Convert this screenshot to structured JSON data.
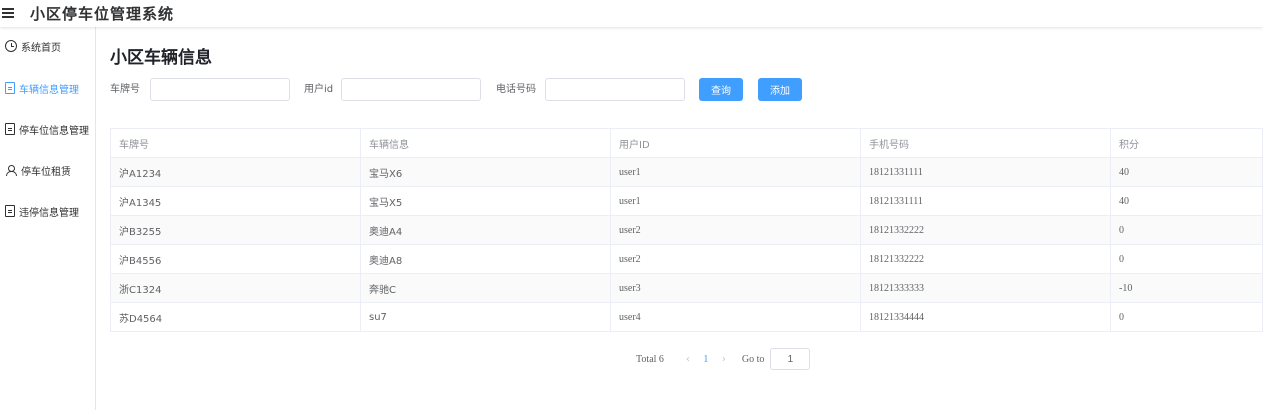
{
  "header": {
    "title": "小区停车位管理系统"
  },
  "sidebar": {
    "items": [
      {
        "label": "系统首页",
        "icon": "clock-icon",
        "active": false
      },
      {
        "label": "车辆信息管理",
        "icon": "document-icon",
        "active": true
      },
      {
        "label": "停车位信息管理",
        "icon": "document-icon",
        "active": false
      },
      {
        "label": "停车位租赁",
        "icon": "user-icon",
        "active": false
      },
      {
        "label": "违停信息管理",
        "icon": "document-icon",
        "active": false
      }
    ]
  },
  "page": {
    "title": "小区车辆信息"
  },
  "search": {
    "plate_label": "车牌号",
    "plate_value": "",
    "userid_label": "用户id",
    "userid_value": "",
    "phone_label": "电话号码",
    "phone_value": "",
    "query_label": "查询",
    "add_label": "添加"
  },
  "table": {
    "headers": [
      "车牌号",
      "车辆信息",
      "用户ID",
      "手机号码",
      "积分"
    ],
    "rows": [
      [
        "沪A1234",
        "宝马X6",
        "user1",
        "18121331111",
        "40"
      ],
      [
        "沪A1345",
        "宝马X5",
        "user1",
        "18121331111",
        "40"
      ],
      [
        "沪B3255",
        "奥迪A4",
        "user2",
        "18121332222",
        "0"
      ],
      [
        "沪B4556",
        "奥迪A8",
        "user2",
        "18121332222",
        "0"
      ],
      [
        "浙C1324",
        "奔驰C",
        "user3",
        "18121333333",
        "-10"
      ],
      [
        "苏D4564",
        "su7",
        "user4",
        "18121334444",
        "0"
      ]
    ]
  },
  "pagination": {
    "total": "Total 6",
    "prev": "‹",
    "current": "1",
    "next": "›",
    "goto_label": "Go to",
    "goto_value": "1"
  },
  "colors": {
    "accent": "#409eff",
    "text": "#303133",
    "muted": "#909399",
    "border": "#ebeef5"
  }
}
